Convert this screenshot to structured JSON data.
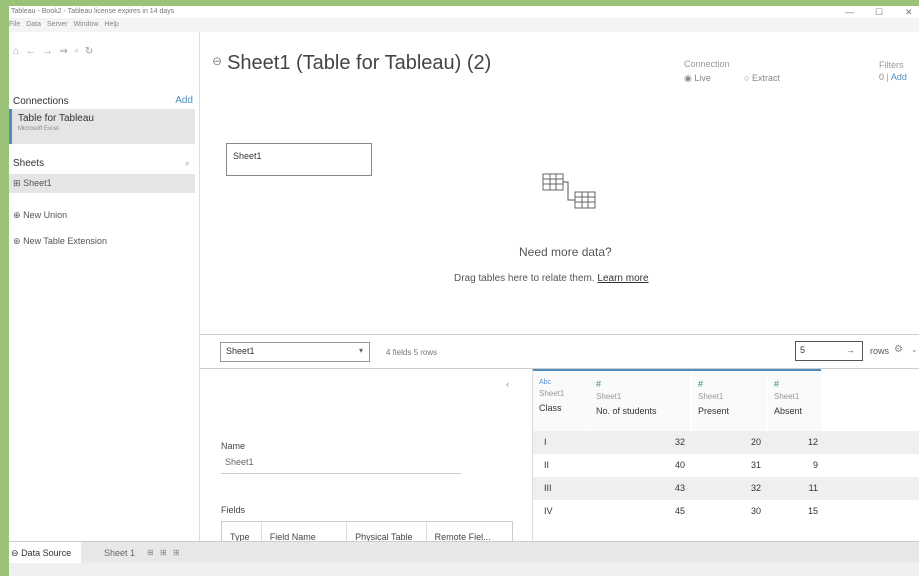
{
  "window": {
    "title": "Tableau - Book2 - Tableau license expires in 14 days",
    "controls": [
      "—",
      "☐",
      "✕"
    ]
  },
  "menu": [
    "File",
    "Data",
    "Server",
    "Window",
    "Help"
  ],
  "toolbar": {
    "icons": [
      "home-icon",
      "back-icon",
      "forward-icon",
      "separator",
      "save-icon",
      "refresh-icon"
    ]
  },
  "left_panel": {
    "connections_label": "Connections",
    "add_label": "Add",
    "connection": {
      "name": "Table for Tableau",
      "type": "Microsoft Excel"
    },
    "sheets_label": "Sheets",
    "sheet_item": "Sheet1",
    "new_union": "New Union",
    "new_table_extension": "New Table Extension"
  },
  "header": {
    "datasource_title": "Sheet1 (Table for Tableau) (2)",
    "connection_label": "Connection",
    "live_label": "Live",
    "extract_label": "Extract",
    "filters_label": "Filters",
    "filters_count": "0",
    "filters_add": "Add"
  },
  "canvas": {
    "table_name": "Sheet1",
    "need_more": "Need more data?",
    "drag_text": "Drag tables here to relate them.",
    "learn_more": "Learn more"
  },
  "grid_toolbar": {
    "sheet_select": "Sheet1",
    "fields_info": "4 fields 5 rows",
    "rows_value": "5",
    "rows_label": "rows"
  },
  "metadata": {
    "name_label": "Name",
    "name_value": "Sheet1",
    "fields_label": "Fields",
    "columns": [
      "Type",
      "Field Name",
      "Physical Table",
      "Remote Fiel..."
    ]
  },
  "grid": {
    "columns": [
      {
        "type": "Abc",
        "source": "Sheet1",
        "name": "Class"
      },
      {
        "type": "#",
        "source": "Sheet1",
        "name": "No. of students"
      },
      {
        "type": "#",
        "source": "Sheet1",
        "name": "Present"
      },
      {
        "type": "#",
        "source": "Sheet1",
        "name": "Absent"
      }
    ],
    "rows": [
      [
        "I",
        "32",
        "20",
        "12"
      ],
      [
        "II",
        "40",
        "31",
        "9"
      ],
      [
        "III",
        "43",
        "32",
        "11"
      ],
      [
        "IV",
        "45",
        "30",
        "15"
      ]
    ]
  },
  "tabs": {
    "data_source": "Data Source",
    "sheet1": "Sheet 1"
  }
}
